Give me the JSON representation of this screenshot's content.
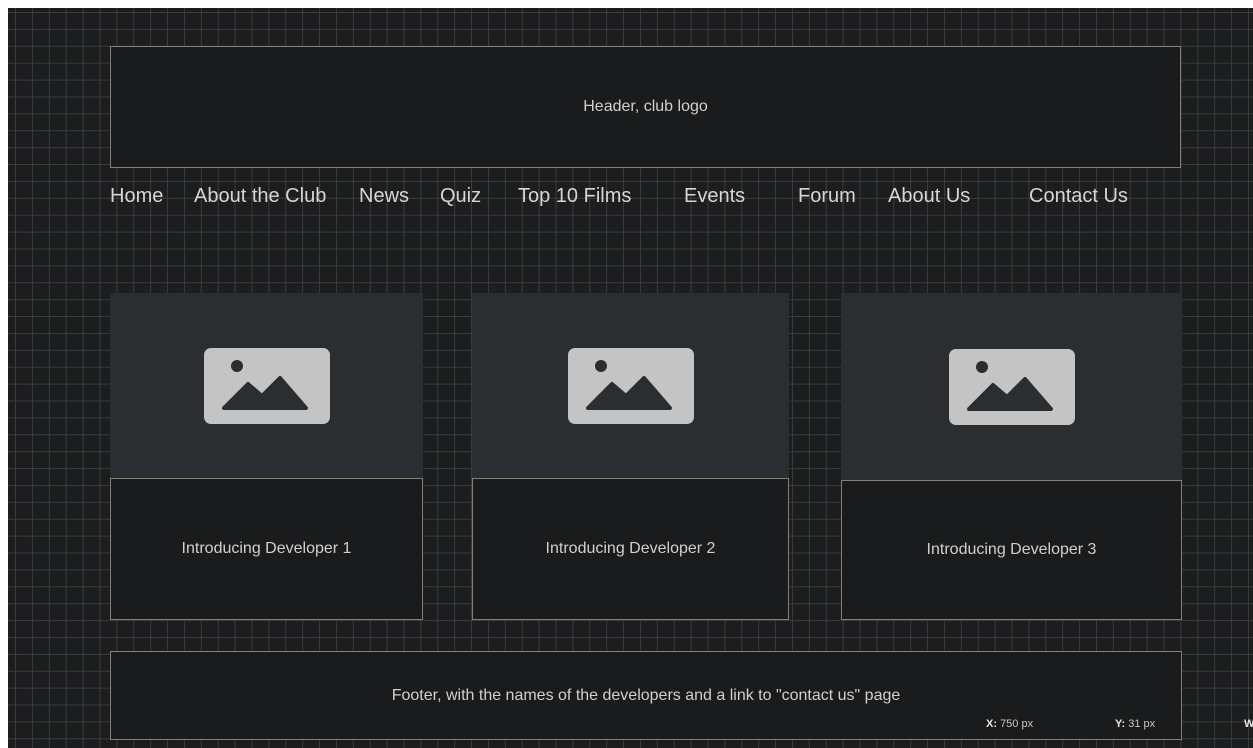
{
  "header": {
    "label": "Header, club logo"
  },
  "nav": {
    "items": [
      {
        "label": "Home"
      },
      {
        "label": "About the Club"
      },
      {
        "label": "News"
      },
      {
        "label": "Quiz"
      },
      {
        "label": "Top 10 Films"
      },
      {
        "label": "Events"
      },
      {
        "label": "Forum"
      },
      {
        "label": "About Us"
      },
      {
        "label": "Contact Us"
      }
    ]
  },
  "cards": [
    {
      "image": "image-placeholder-icon",
      "caption": "Introducing Developer 1"
    },
    {
      "image": "image-placeholder-icon",
      "caption": "Introducing Developer 2"
    },
    {
      "image": "image-placeholder-icon",
      "caption": "Introducing Developer 3"
    }
  ],
  "footer": {
    "label": "Footer, with the names of the developers and a link to \"contact us\" page"
  },
  "coords": {
    "x_label": "X:",
    "x_value": "750 px",
    "y_label": "Y:",
    "y_value": "31 px",
    "w_label": "W"
  },
  "colors": {
    "canvas_bg": "#1c1d1e",
    "grid_line": "#3a3c3d",
    "frame_border": "#8a7f6d",
    "image_card_bg": "#2b2e31",
    "placeholder_icon": "#c4c4c4",
    "text": "#d0d0d0"
  }
}
